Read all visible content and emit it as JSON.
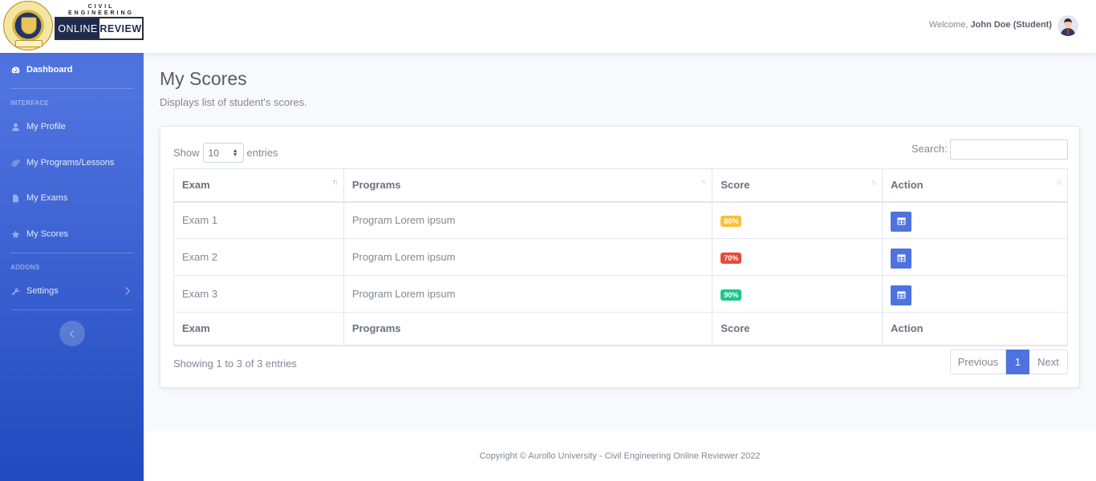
{
  "brand": {
    "top": "CIVIL ENGINEERING",
    "online": "ONLINE",
    "review": "REVIEW"
  },
  "user": {
    "welcome": "Welcome,",
    "name": "John Doe (Student)"
  },
  "sidebar": {
    "dashboard": "Dashboard",
    "heading_interface": "INTERFACE",
    "heading_addons": "ADDONS",
    "items": [
      "My Profile",
      "My Programs/Lessons",
      "My Exams",
      "My Scores"
    ],
    "settings": "Settings"
  },
  "page": {
    "title": "My Scores",
    "subtitle": "Displays list of student's scores."
  },
  "table_controls": {
    "show": "Show",
    "entries_value": "10",
    "entries": "entries",
    "search_label": "Search:",
    "search_value": ""
  },
  "table": {
    "columns": [
      "Exam",
      "Programs",
      "Score",
      "Action"
    ],
    "rows": [
      {
        "exam": "Exam 1",
        "program": "Program Lorem ipsum",
        "score": "80%",
        "score_color": "#f6c23e"
      },
      {
        "exam": "Exam 2",
        "program": "Program Lorem ipsum",
        "score": "70%",
        "score_color": "#e74a3b"
      },
      {
        "exam": "Exam 3",
        "program": "Program Lorem ipsum",
        "score": "90%",
        "score_color": "#1cc88a"
      }
    ]
  },
  "pagination": {
    "info": "Showing 1 to 3 of 3 entries",
    "previous": "Previous",
    "current": "1",
    "next": "Next"
  },
  "footer": {
    "text": "Copyright © Aurollo University - Civil Engineering Online Reviewer 2022"
  },
  "colors": {
    "primary": "#4e73df",
    "sidebar_bottom": "#224abe",
    "warning": "#f6c23e",
    "danger": "#e74a3b",
    "success": "#1cc88a"
  },
  "icons": [
    "tachometer-icon",
    "user-icon",
    "paperclip-icon",
    "file-icon",
    "star-icon",
    "wrench-icon",
    "chevron-right-icon",
    "chevron-left-icon",
    "table-icon"
  ]
}
